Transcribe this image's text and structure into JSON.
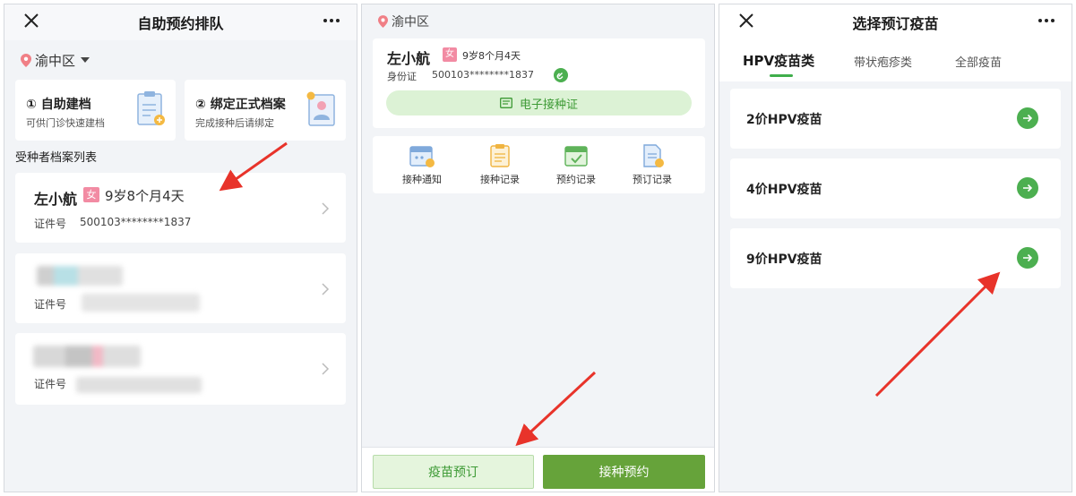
{
  "colors": {
    "accent_green": "#3fae4b",
    "primary_btn": "#66a33a",
    "female_badge": "#f28ba3",
    "annotation_arrow": "#e8332a"
  },
  "panel1": {
    "title": "自助预约排队",
    "district": "渝中区",
    "quick_cards": [
      {
        "title": "① 自助建档",
        "subtitle": "可供门诊快速建档",
        "icon": "clipboard-add-icon"
      },
      {
        "title": "② 绑定正式档案",
        "subtitle": "完成接种后请绑定",
        "icon": "profile-card-icon"
      }
    ],
    "section_label": "受种者档案列表",
    "records": [
      {
        "name": "左小航",
        "sex": "女",
        "age": "9岁8个月4天",
        "id_label": "证件号",
        "id_value": "500103********1837"
      },
      {
        "id_label": "证件号"
      },
      {
        "id_label": "证件号"
      }
    ]
  },
  "panel2": {
    "district": "渝中区",
    "person": {
      "name": "左小航",
      "sex": "女",
      "age": "9岁8个月4天",
      "id_label": "身份证",
      "id_value": "500103********1837"
    },
    "cert_button": "电子接种证",
    "menu": [
      {
        "label": "接种通知",
        "icon": "calendar-notice-icon"
      },
      {
        "label": "接种记录",
        "icon": "record-list-icon"
      },
      {
        "label": "预约记录",
        "icon": "appointment-check-icon"
      },
      {
        "label": "预订记录",
        "icon": "booking-doc-icon"
      }
    ],
    "bottom": {
      "book_label": "疫苗预订",
      "appointment_label": "接种预约"
    }
  },
  "panel3": {
    "title": "选择预订疫苗",
    "tabs": [
      {
        "label": "HPV疫苗类",
        "active": true
      },
      {
        "label": "带状疱疹类",
        "active": false
      },
      {
        "label": "全部疫苗",
        "active": false
      }
    ],
    "vaccines": [
      {
        "name": "2价HPV疫苗"
      },
      {
        "name": "4价HPV疫苗"
      },
      {
        "name": "9价HPV疫苗"
      }
    ]
  }
}
